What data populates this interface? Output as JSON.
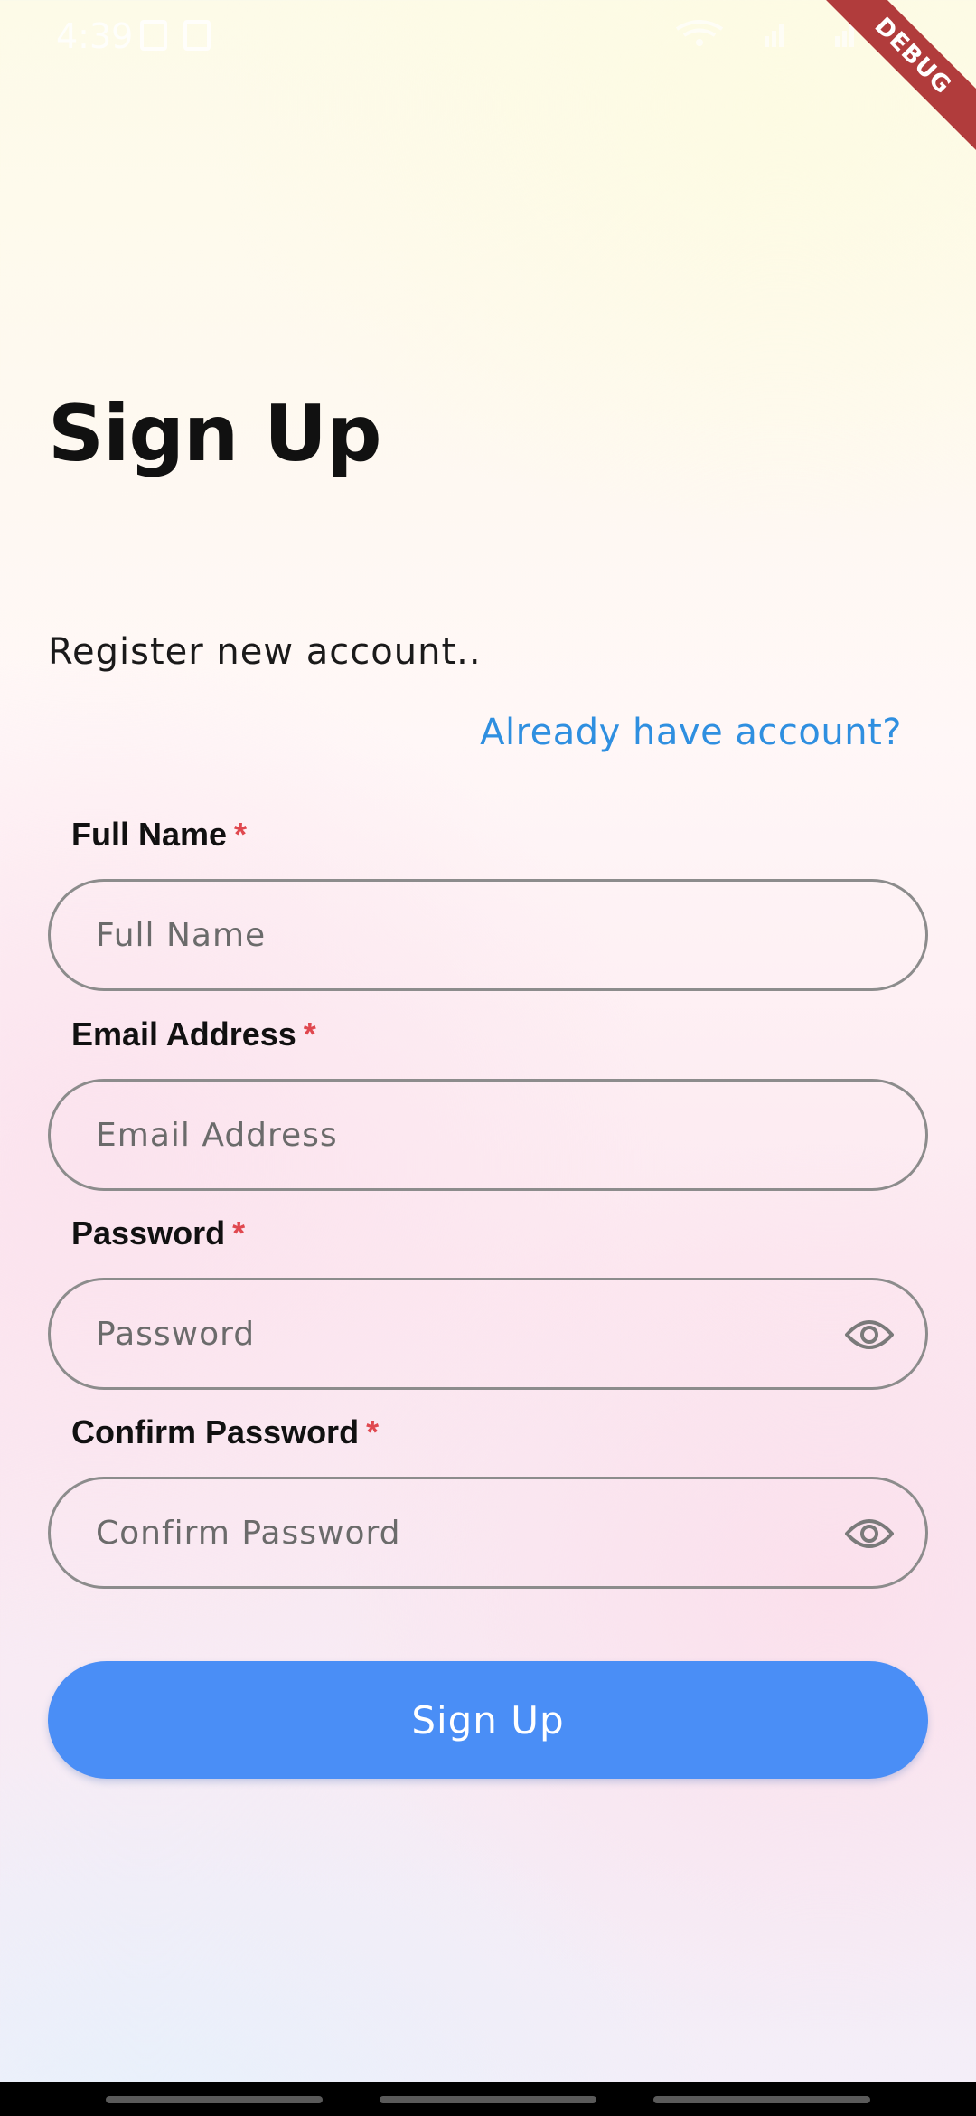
{
  "status_bar": {
    "time": "4:39"
  },
  "debug_banner": {
    "label": "DEBUG"
  },
  "header": {
    "title": "Sign Up",
    "subtitle": "Register new account..",
    "login_link": "Already have account?"
  },
  "form": {
    "required_marker": "*",
    "full_name": {
      "label": "Full Name",
      "placeholder": "Full Name",
      "value": ""
    },
    "email": {
      "label": "Email Address",
      "placeholder": "Email Address",
      "value": ""
    },
    "password": {
      "label": "Password",
      "placeholder": "Password",
      "value": "",
      "toggle_icon": "eye-icon"
    },
    "confirm_password": {
      "label": "Confirm Password",
      "placeholder": "Confirm Password",
      "value": "",
      "toggle_icon": "eye-icon"
    },
    "submit_label": "Sign Up"
  },
  "colors": {
    "accent": "#4a8ef6",
    "link": "#2f8fe0",
    "required": "#e0484f",
    "debug_banner": "#b13c3c"
  }
}
